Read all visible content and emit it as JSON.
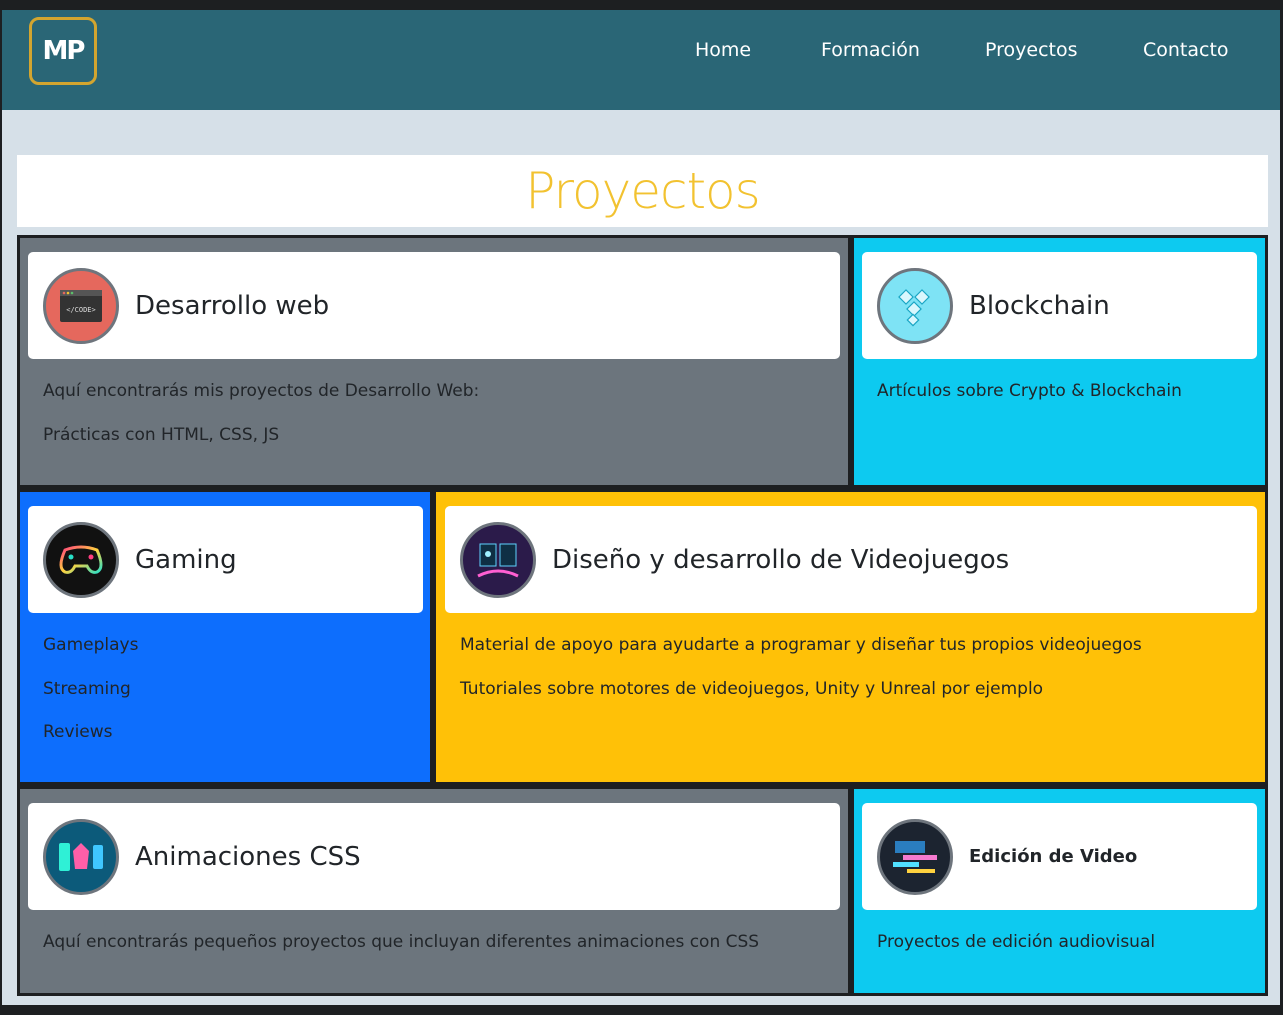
{
  "brand": {
    "logo_text": "MP"
  },
  "nav": {
    "items": [
      {
        "label": "Home"
      },
      {
        "label": "Formación"
      },
      {
        "label": "Proyectos"
      },
      {
        "label": "Contacto"
      }
    ]
  },
  "page": {
    "title": "Proyectos"
  },
  "colors": {
    "navbar": "#2a6676",
    "title": "#f2c230",
    "gray": "#6c757d",
    "cyan": "#0dcaf0",
    "blue": "#0d6efd",
    "yellow": "#ffc107"
  },
  "sections": {
    "web": {
      "icon": "code-window-icon",
      "icon_label": "</CODE>",
      "title": "Desarrollo web",
      "lines": [
        "Aquí encontrarás mis proyectos de Desarrollo Web:",
        "Prácticas con HTML, CSS, JS"
      ]
    },
    "blockchain": {
      "icon": "blockchain-blocks-icon",
      "title": "Blockchain",
      "lines": [
        "Artículos sobre Crypto & Blockchain"
      ]
    },
    "gaming": {
      "icon": "gamepad-icon",
      "title": "Gaming",
      "lines": [
        "Gameplays",
        "Streaming",
        "Reviews"
      ]
    },
    "gamedev": {
      "icon": "game-dev-icon",
      "title": "Diseño y desarrollo de Videojuegos",
      "lines": [
        "Material de apoyo para ayudarte a programar y diseñar tus propios videojuegos",
        "Tutoriales sobre motores de videojuegos, Unity y Unreal por ejemplo"
      ]
    },
    "css": {
      "icon": "css-animation-icon",
      "title": "Animaciones CSS",
      "lines": [
        "Aquí encontrarás pequeños proyectos que incluyan diferentes animaciones con CSS"
      ]
    },
    "video": {
      "icon": "video-editing-icon",
      "title": "Edición de Video",
      "lines": [
        "Proyectos de edición audiovisual"
      ]
    }
  }
}
